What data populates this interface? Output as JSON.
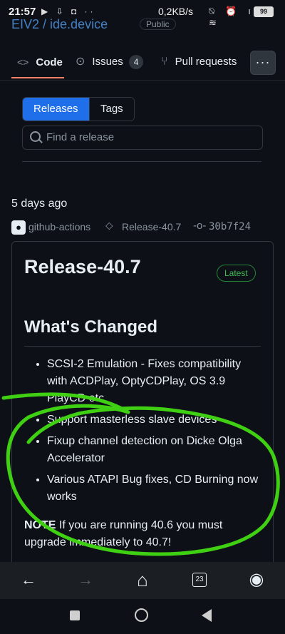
{
  "status_bar": {
    "time": "21:57",
    "notification_icons": "▶ ⇩ ◘ ··",
    "network_speed": "0,2KB/s",
    "right_icons": "⍉ ⏰ ıll ≋",
    "battery": "99"
  },
  "repo_header": {
    "title": "EIV2 / ide.device",
    "visibility": "Public"
  },
  "tabs": {
    "code": {
      "label": "Code",
      "icon": "<>"
    },
    "issues": {
      "label": "Issues",
      "count": "4",
      "icon": "⊙"
    },
    "pulls": {
      "label": "Pull requests",
      "icon": "⑂"
    },
    "more": "···"
  },
  "segmented": {
    "releases": "Releases",
    "tags": "Tags"
  },
  "search": {
    "placeholder": "Find a release"
  },
  "release": {
    "date": "5 days ago",
    "actor": "github-actions",
    "tag": "Release-40.7",
    "commit": "30b7f24",
    "title": "Release-40.7",
    "latest_badge": "Latest",
    "changes_heading": "What's Changed",
    "changes": [
      "SCSI-2 Emulation - Fixes compatibility with ACDPlay, OptyCDPlay, OS 3.9 PlayCD etc",
      "Support masterless slave devices",
      "Fixup channel detection on Dicke Olga Accelerator",
      "Various ATAPI Bug fixes, CD Burning now works"
    ],
    "note_label": "NOTE",
    "note_text": " If you are running 40.6 you must upgrade immediately to 40.7!"
  },
  "browser_nav": {
    "back": "←",
    "forward": "→",
    "home": "⌂",
    "tab_count": "23",
    "account": "◉"
  },
  "colors": {
    "accent_blue": "#1f6feb",
    "annotation_green": "#3fd013",
    "latest_green": "#3fb950",
    "code_tab_underline": "#f78166"
  }
}
